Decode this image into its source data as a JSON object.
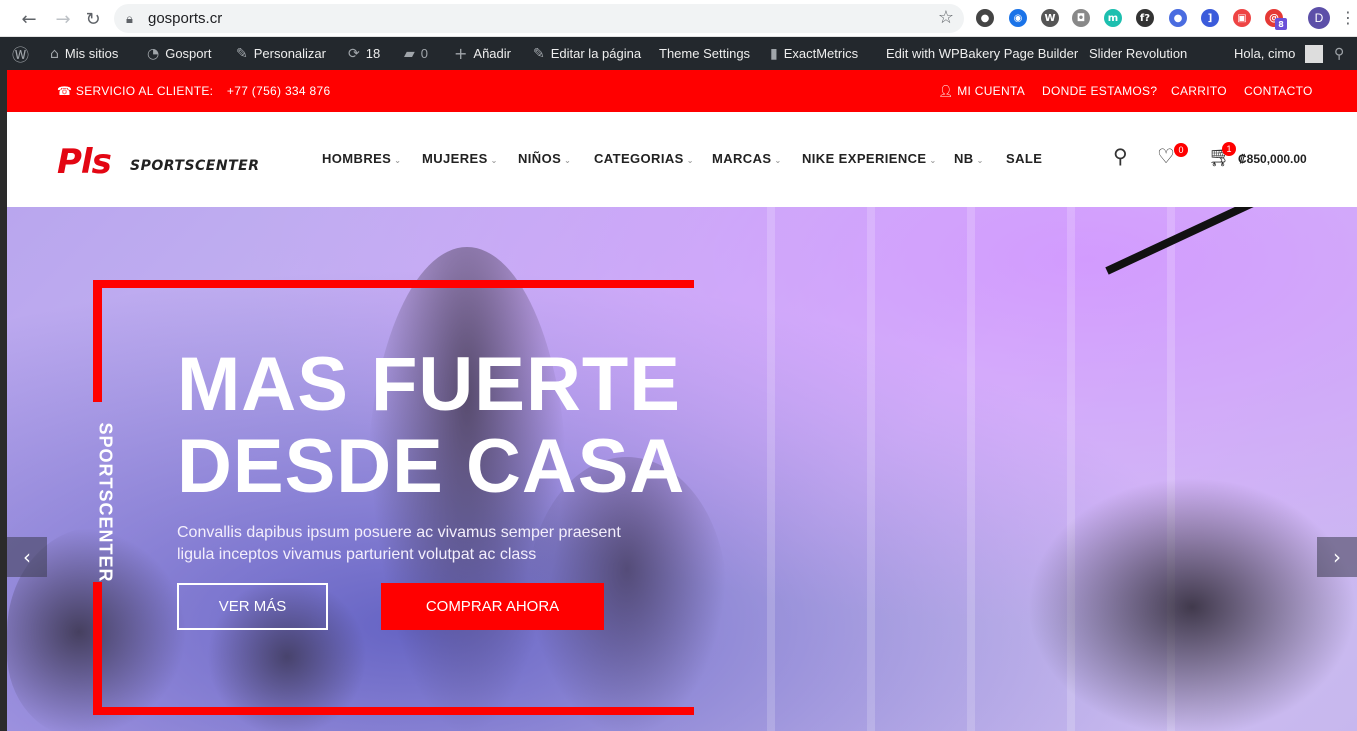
{
  "browser": {
    "url": "gosports.cr",
    "profile_initial": "D",
    "extensions": [
      {
        "name": "ext-colorful-icon",
        "glyph": "●",
        "color": "#444"
      },
      {
        "name": "ext-blue-square-icon",
        "glyph": "◉",
        "color": "#1a73e8"
      },
      {
        "name": "ext-wordpress-icon",
        "glyph": "W",
        "color": "#555"
      },
      {
        "name": "ext-camera-icon",
        "glyph": "◘",
        "color": "#888"
      },
      {
        "name": "ext-m-icon",
        "glyph": "m",
        "color": "#1dbfaf"
      },
      {
        "name": "ext-f-icon",
        "glyph": "f?",
        "color": "#333"
      },
      {
        "name": "ext-orb-icon",
        "glyph": "●",
        "color": "#4a6ce0"
      },
      {
        "name": "ext-bracket-icon",
        "glyph": "]",
        "color": "#3b5bdb"
      },
      {
        "name": "ext-frame-icon",
        "glyph": "▣",
        "color": "#e44"
      },
      {
        "name": "ext-red-spiral-icon",
        "glyph": "@",
        "color": "#e53935",
        "badge": "8"
      }
    ]
  },
  "wpbar": {
    "mis_sitios": "Mis sitios",
    "site": "Gosport",
    "personalizar": "Personalizar",
    "updates": "18",
    "comments": "0",
    "anadir": "Añadir",
    "editar": "Editar la página",
    "theme_settings": "Theme Settings",
    "exactmetrics": "ExactMetrics",
    "wpbakery": "Edit with WPBakery Page Builder",
    "slider": "Slider Revolution",
    "greeting": "Hola, cimo"
  },
  "topbar": {
    "service_label": "SERVICIO AL CLIENTE:",
    "phone": "+77 (756) 334 876",
    "account": "MI CUENTA",
    "where": "DONDE ESTAMOS?",
    "cart": "CARRITO",
    "contact": "CONTACTO"
  },
  "header": {
    "logo_mark": "Pls",
    "logo_text": "SPORTSCENTER",
    "menu": [
      "HOMBRES",
      "MUJERES",
      "NIÑOS",
      "CATEGORIAS",
      "MARCAS",
      "NIKE EXPERIENCE",
      "NB",
      "SALE"
    ],
    "wishlist_count": "0",
    "cart_count": "1",
    "cart_total": "₡850,000.00"
  },
  "hero": {
    "vertical_brand": "SPORTSCENTER",
    "headline_line1": "MAS FUERTE",
    "headline_line2": "DESDE CASA",
    "subtext": "Convallis dapibus ipsum posuere ac vivamus semper praesent ligula inceptos vivamus parturient volutpat ac class",
    "btn_more": "VER MÁS",
    "btn_buy": "COMPRAR AHORA",
    "accent": "#ff0000"
  }
}
